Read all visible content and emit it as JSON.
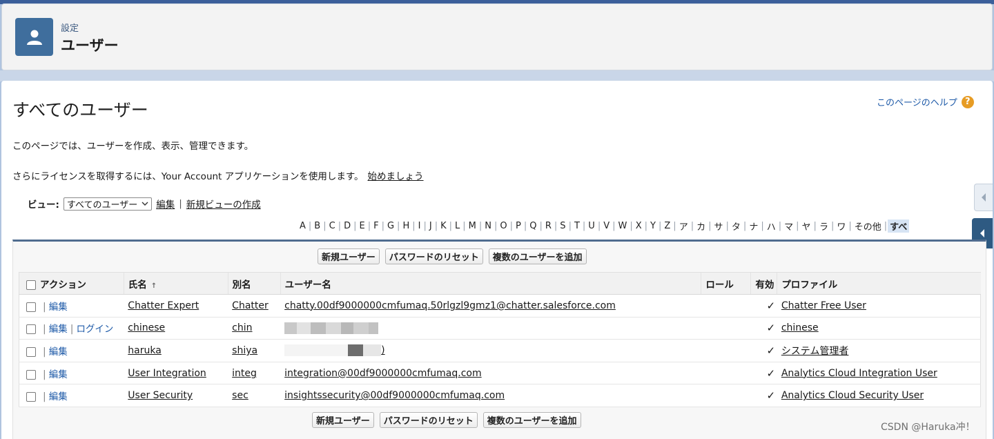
{
  "header": {
    "breadcrumb": "設定",
    "title": "ユーザー",
    "icon": "user-icon"
  },
  "page": {
    "title": "すべてのユーザー",
    "help_link": "このページのヘルプ",
    "help_icon": "question-icon",
    "description": "このページでは、ユーザーを作成、表示、管理できます。",
    "license_text": "さらにライセンスを取得するには、Your Account アプリケーションを使用します。",
    "license_link": "始めましょう"
  },
  "view": {
    "label": "ビュー:",
    "selected": "すべてのユーザー",
    "edit_link": "編集",
    "separator": "|",
    "new_view_link": "新規ビューの作成"
  },
  "alphabet": {
    "letters": [
      "A",
      "B",
      "C",
      "D",
      "E",
      "F",
      "G",
      "H",
      "I",
      "J",
      "K",
      "L",
      "M",
      "N",
      "O",
      "P",
      "Q",
      "R",
      "S",
      "T",
      "U",
      "V",
      "W",
      "X",
      "Y",
      "Z",
      "ア",
      "カ",
      "サ",
      "タ",
      "ナ",
      "ハ",
      "マ",
      "ヤ",
      "ラ",
      "ワ",
      "その他"
    ],
    "active": "すべ"
  },
  "buttons": {
    "new_user": "新規ユーザー",
    "reset_password": "パスワードのリセット",
    "add_multiple": "複数のユーザーを追加"
  },
  "table": {
    "columns": {
      "action": "アクション",
      "name": "氏名",
      "alias": "別名",
      "username": "ユーザー名",
      "role": "ロール",
      "active": "有効",
      "profile": "プロファイル"
    },
    "sort_indicator": "↑",
    "edit_label": "編集",
    "login_label": "ログイン",
    "check_mark": "✓",
    "rows": [
      {
        "name": "Chatter Expert",
        "alias": "Chatter",
        "username": "chatty.00df9000000cmfumaq.50rlgzl9gmz1@chatter.salesforce.com",
        "role": "",
        "profile": "Chatter Free User",
        "login": false
      },
      {
        "name": "chinese",
        "alias": "chin",
        "username": "",
        "role": "",
        "profile": "chinese",
        "login": true
      },
      {
        "name": "haruka",
        "alias": "shiya",
        "username": ")",
        "role": "",
        "profile": "システム管理者",
        "login": false
      },
      {
        "name": "User Integration",
        "alias": "integ",
        "username": "integration@00df9000000cmfumaq.com",
        "role": "",
        "profile": "Analytics Cloud Integration User",
        "login": false
      },
      {
        "name": "User Security",
        "alias": "sec",
        "username": "insightssecurity@00df9000000cmfumaq.com",
        "role": "",
        "profile": "Analytics Cloud Security User",
        "login": false
      }
    ]
  },
  "watermark": "CSDN @Haruka冲！"
}
